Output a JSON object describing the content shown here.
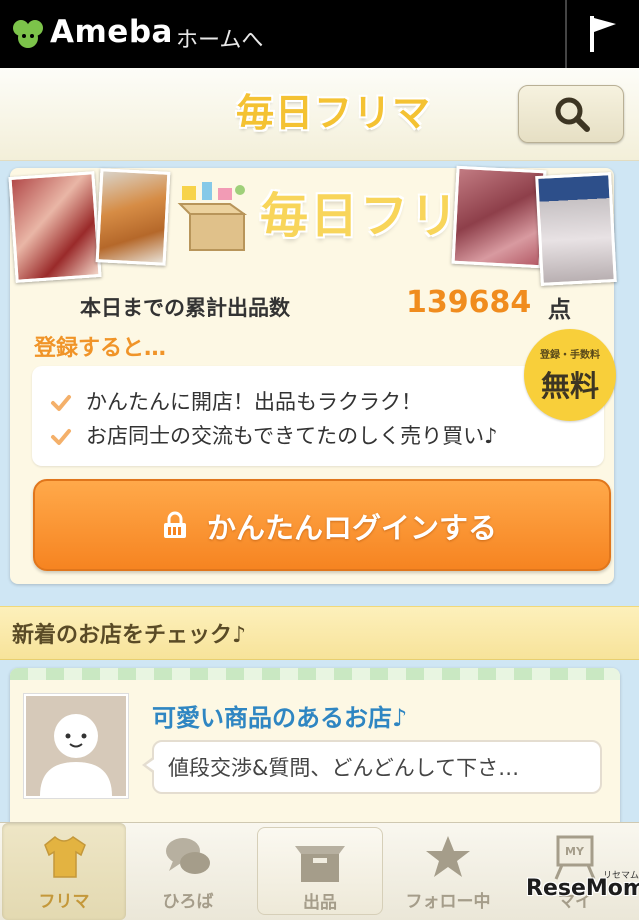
{
  "topbar": {
    "brand": "Ameba",
    "home_link": "ホームへ",
    "logo_icon": "ameba-leaf-icon",
    "flag_icon": "flag-icon"
  },
  "header": {
    "title": "毎日フリマ",
    "search_icon": "magnifier-icon"
  },
  "banner": {
    "title": "毎日フリマ",
    "count_label": "本日までの累計出品数",
    "count_value": "139684",
    "count_unit": "点",
    "register_text": "登録すると…",
    "free_badge_small": "登録・手数料",
    "free_badge_big": "無料",
    "features": [
      "かんたんに開店！出品もラクラク！",
      "お店同士の交流もできてたのしく売り買い♪"
    ],
    "login_button": "かんたんログインする"
  },
  "section": {
    "title": "新着のお店をチェック♪"
  },
  "shop": {
    "name": "可愛い商品のあるお店♪",
    "message": "値段交渉&質問、どんどんして下さ…"
  },
  "tabs": [
    {
      "label": "フリマ",
      "icon": "tshirt-icon",
      "active": true
    },
    {
      "label": "ひろば",
      "icon": "chat-bubbles-icon",
      "active": false
    },
    {
      "label": "出品",
      "icon": "box-icon",
      "active": false
    },
    {
      "label": "フォロー中",
      "icon": "star-icon",
      "active": false
    },
    {
      "label": "マイ",
      "icon": "my-board-icon",
      "active": false
    }
  ],
  "colors": {
    "accent_orange": "#f68421",
    "brand_yellow": "#f8d55a",
    "link_blue": "#2f86c2"
  },
  "watermark": {
    "text": "ReseMom",
    "small": "リセマム"
  }
}
